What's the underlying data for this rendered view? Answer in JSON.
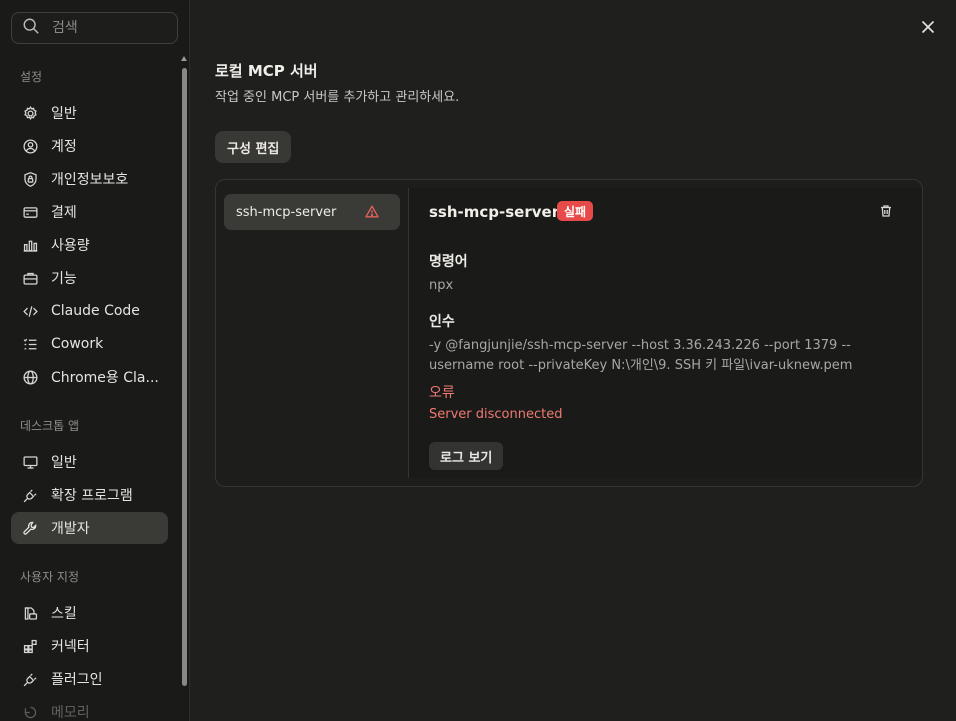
{
  "sidebar": {
    "search": {
      "placeholder": "검색",
      "value": ""
    },
    "sections": [
      {
        "title": "설정",
        "items": [
          {
            "label": "일반",
            "icon": "gear-icon"
          },
          {
            "label": "계정",
            "icon": "user-circle-icon"
          },
          {
            "label": "개인정보보호",
            "icon": "shield-lock-icon"
          },
          {
            "label": "결제",
            "icon": "credit-card-icon"
          },
          {
            "label": "사용량",
            "icon": "bar-chart-icon"
          },
          {
            "label": "기능",
            "icon": "briefcase-icon"
          },
          {
            "label": "Claude Code",
            "icon": "code-icon"
          },
          {
            "label": "Cowork",
            "icon": "checklist-icon"
          },
          {
            "label": "Chrome용 Cla...",
            "icon": "globe-icon"
          }
        ]
      },
      {
        "title": "데스크톱 앱",
        "items": [
          {
            "label": "일반",
            "icon": "monitor-icon"
          },
          {
            "label": "확장 프로그램",
            "icon": "plug-icon"
          },
          {
            "label": "개발자",
            "icon": "wrench-icon",
            "active": true
          }
        ]
      },
      {
        "title": "사용자 지정",
        "items": [
          {
            "label": "스킬",
            "icon": "skill-icon"
          },
          {
            "label": "커넥터",
            "icon": "connector-icon"
          },
          {
            "label": "플러그인",
            "icon": "plug-icon"
          },
          {
            "label": "메모리",
            "icon": "memory-icon"
          }
        ]
      }
    ]
  },
  "main": {
    "title": "로컬 MCP 서버",
    "subtitle": "작업 중인 MCP 서버를 추가하고 관리하세요.",
    "edit_config_label": "구성 편집",
    "servers": [
      {
        "name": "ssh-mcp-server",
        "status_icon": "warning-triangle-icon"
      }
    ],
    "detail": {
      "name": "ssh-mcp-server",
      "status_badge": "실패",
      "command_label": "명령어",
      "command_value": "npx",
      "args_label": "인수",
      "args_line1": "-y @fangjunjie/ssh-mcp-server --host 3.36.243.226 --port 1379 --",
      "args_line2": "username root --privateKey N:\\개인\\9. SSH 키 파일\\ivar-uknew.pem",
      "error_label": "오류",
      "error_value": "Server disconnected",
      "view_logs_label": "로그 보기"
    }
  },
  "colors": {
    "background": "#1f1f1e",
    "sidebar": "#1a1a19",
    "active_item": "#3a3a37",
    "error": "#ee7a72",
    "badge_fail": "#e84a4a"
  }
}
